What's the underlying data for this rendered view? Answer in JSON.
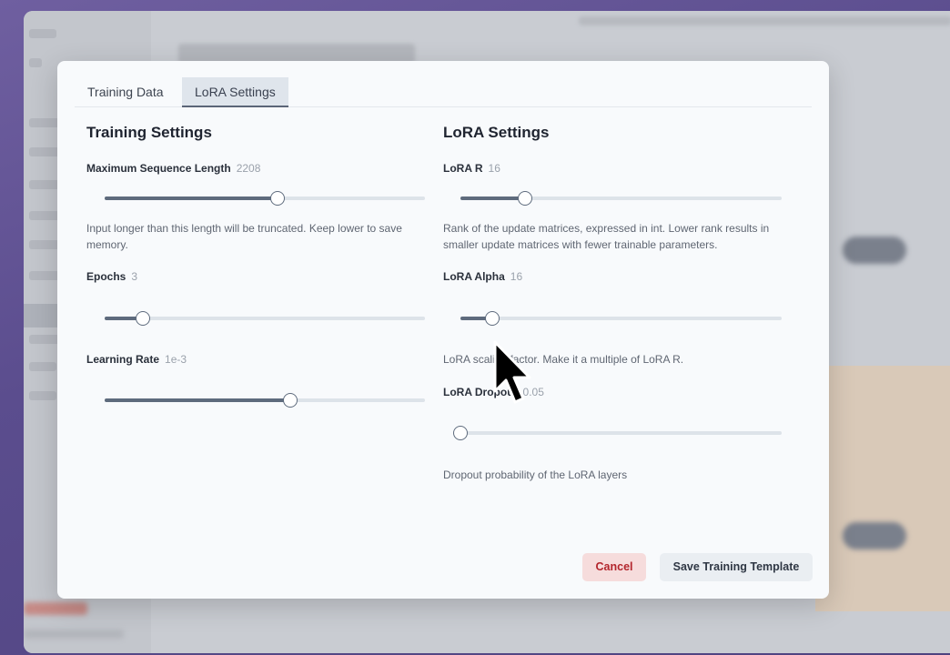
{
  "tabs": [
    {
      "label": "Training Data",
      "active": false
    },
    {
      "label": "LoRA Settings",
      "active": true
    }
  ],
  "training": {
    "title": "Training Settings",
    "max_seq": {
      "label": "Maximum Sequence Length",
      "value": "2208",
      "fraction": 0.54,
      "help": "Input longer than this length will be truncated. Keep lower to save memory."
    },
    "epochs": {
      "label": "Epochs",
      "value": "3",
      "fraction": 0.12
    },
    "learning_rate": {
      "label": "Learning Rate",
      "value": "1e-3",
      "fraction": 0.58
    }
  },
  "lora": {
    "title": "LoRA Settings",
    "r": {
      "label": "LoRA R",
      "value": "16",
      "fraction": 0.2,
      "help": "Rank of the update matrices, expressed in int. Lower rank results in smaller update matrices with fewer trainable parameters."
    },
    "alpha": {
      "label": "LoRA Alpha",
      "value": "16",
      "fraction": 0.1,
      "help": "LoRA scaling factor. Make it a multiple of LoRA R."
    },
    "dropout": {
      "label": "LoRA Dropout",
      "value": "0.05",
      "fraction": 0.0,
      "help": "Dropout probability of the LoRA layers"
    }
  },
  "actions": {
    "cancel_label": "Cancel",
    "save_label": "Save Training Template"
  },
  "colors": {
    "slider_fill": "#5e6b7d",
    "cancel_text": "#b3262d",
    "cancel_bg": "#f6dcdc"
  }
}
